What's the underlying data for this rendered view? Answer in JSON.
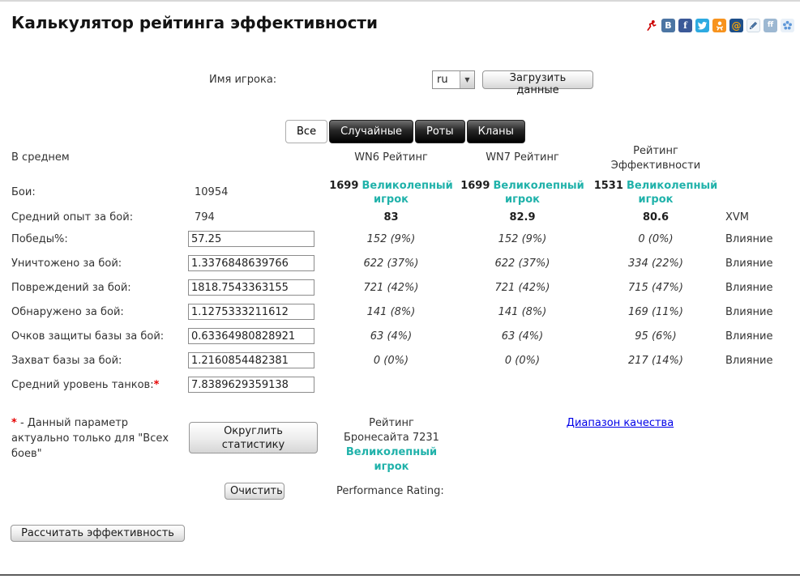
{
  "page": {
    "title": "Калькулятор рейтинга эффективности"
  },
  "social": {
    "icons": [
      {
        "name": "liveinternet"
      },
      {
        "name": "vkontakte",
        "glyph": "В"
      },
      {
        "name": "facebook",
        "glyph": "f"
      },
      {
        "name": "twitter"
      },
      {
        "name": "odnoklassniki"
      },
      {
        "name": "mailru",
        "glyph": "@"
      },
      {
        "name": "livejournal"
      },
      {
        "name": "friendfeed",
        "glyph": "ff"
      },
      {
        "name": "share"
      }
    ]
  },
  "form": {
    "player_label": "Имя игрока:",
    "player_value": "",
    "server": "ru",
    "load_button": "Загрузить данные"
  },
  "tabs": [
    {
      "label": "Все",
      "active": true
    },
    {
      "label": "Случайные",
      "active": false
    },
    {
      "label": "Роты",
      "active": false
    },
    {
      "label": "Кланы",
      "active": false
    }
  ],
  "table": {
    "headers": {
      "left": "В среднем",
      "wn6": "WN6 Рейтинг",
      "wn7": "WN7 Рейтинг",
      "re": "Рейтинг Эффективности"
    },
    "battles": {
      "label": "Бои:",
      "value": "10954",
      "wn6_score": "1699",
      "wn6_grade": "Великолепный игрок",
      "wn7_score": "1699",
      "wn7_grade": "Великолепный игрок",
      "re_score": "1531",
      "re_grade": "Великолепный игрок"
    },
    "avg_exp": {
      "label": "Средний опыт за бой:",
      "value": "794",
      "wn6": "83",
      "wn7": "82.9",
      "re": "80.6",
      "extra": "XVM"
    },
    "input_rows": [
      {
        "label": "Победы%:",
        "input": "57.25",
        "wn6": "152 (9%)",
        "wn7": "152 (9%)",
        "re": "0 (0%)",
        "extra": "Влияние"
      },
      {
        "label": "Уничтожено за бой:",
        "input": "1.3376848639766",
        "wn6": "622 (37%)",
        "wn7": "622 (37%)",
        "re": "334 (22%)",
        "extra": "Влияние"
      },
      {
        "label": "Повреждений за бой:",
        "input": "1818.7543363155",
        "wn6": "721 (42%)",
        "wn7": "721 (42%)",
        "re": "715 (47%)",
        "extra": "Влияние"
      },
      {
        "label": "Обнаружено за бой:",
        "input": "1.1275333211612",
        "wn6": "141 (8%)",
        "wn7": "141 (8%)",
        "re": "169 (11%)",
        "extra": "Влияние"
      },
      {
        "label": "Очков защиты базы за бой:",
        "input": "0.63364980828921",
        "wn6": "63 (4%)",
        "wn7": "63 (4%)",
        "re": "95 (6%)",
        "extra": "Влияние"
      },
      {
        "label": "Захват базы за бой:",
        "input": "1.2160854482381",
        "wn6": "0 (0%)",
        "wn7": "0 (0%)",
        "re": "217 (14%)",
        "extra": "Влияние"
      },
      {
        "label": "Средний уровень танков:",
        "required": "*",
        "input": "7.8389629359138"
      }
    ]
  },
  "footer": {
    "note_mark": "*",
    "note_text": " - Данный параметр актуально только для \"Всех боев\"",
    "round_button": "Округлить статистику",
    "bronesite_text": "Рейтинг Бронесайта 7231",
    "bronesite_grade": "Великолепный игрок",
    "quality_link": "Диапазон качества",
    "clear_button": "Очистить",
    "performance_label": "Performance Rating:",
    "calc_button": "Рассчитать эффективность"
  },
  "colors": {
    "grade_teal": "#20b2aa",
    "link_blue": "#0000e8",
    "required_red": "#e60000"
  }
}
